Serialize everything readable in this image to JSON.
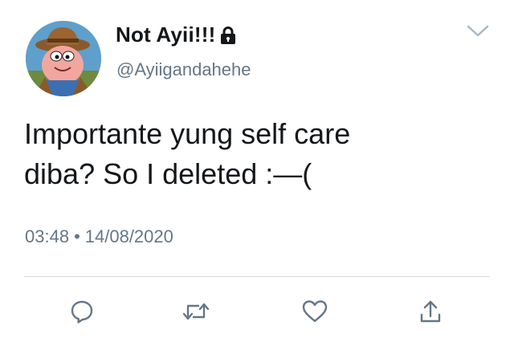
{
  "tweet": {
    "display_name": "Not Ayii!!!",
    "handle": "@Ayiigandahehe",
    "text": "Importante yung self care\ndiba? So I deleted :—(",
    "time": "03:48",
    "separator": "•",
    "date": "14/08/2020"
  },
  "icons": {
    "lock": "lock-icon",
    "more": "chevron-down-icon",
    "reply": "reply-icon",
    "retweet": "retweet-icon",
    "like": "heart-icon",
    "share": "share-icon"
  },
  "colors": {
    "text": "#14171a",
    "secondary": "#657786",
    "icon": "#657786",
    "divider": "#d6dbe0"
  }
}
